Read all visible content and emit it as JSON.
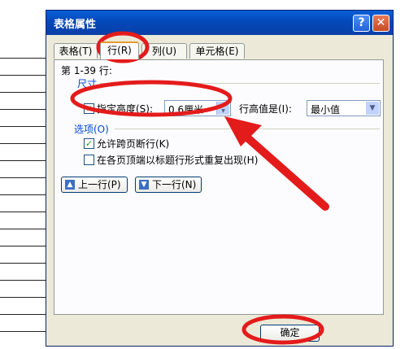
{
  "dialog": {
    "title": "表格属性",
    "help_label": "?",
    "close_label": "✕"
  },
  "tabs": [
    {
      "label": "表格(T)"
    },
    {
      "label": "行(R)"
    },
    {
      "label": "列(U)"
    },
    {
      "label": "单元格(E)"
    }
  ],
  "row_tab": {
    "rows_label": "第 1-39 行:",
    "size_group": "尺寸",
    "specify_height_label": "指定高度(S):",
    "specify_height_checked": true,
    "height_value": "0.6厘米",
    "row_height_is_label": "行高值是(I):",
    "row_height_is_value": "最小值",
    "options_group": "选项(O)",
    "allow_break_label": "允许跨页断行(K)",
    "allow_break_checked": true,
    "repeat_header_label": "在各页顶端以标题行形式重复出现(H)",
    "repeat_header_checked": false,
    "prev_row_label": "上一行(P)",
    "next_row_label": "下一行(N)"
  },
  "footer": {
    "ok_label": "确定"
  },
  "colors": {
    "annotation_red": "#e41b1b",
    "titlebar_blue": "#0348b8",
    "group_label_blue": "#0046d5"
  }
}
